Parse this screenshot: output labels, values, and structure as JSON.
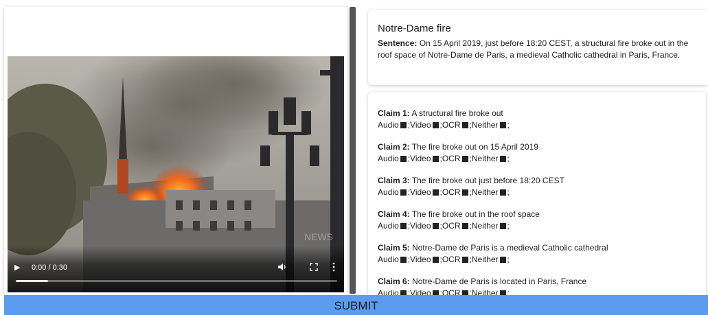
{
  "video": {
    "time": "0:00 / 0:30",
    "progress_fraction": 0.1,
    "watermark": "NEWS"
  },
  "sentence": {
    "title": "Notre-Dame fire",
    "label": "Sentence:",
    "text": " On 15 April 2019, just before 18:20 CEST, a structural fire broke out in the roof space of Notre-Dame de Paris, a medieval Catholic cathedral in Paris, France."
  },
  "claim_options": {
    "audio": "Audio",
    "video": ";Video",
    "ocr": ";OCR",
    "neither": ";Neither",
    "end": ";"
  },
  "claims": [
    {
      "label": "Claim 1:",
      "text": " A structural fire broke out"
    },
    {
      "label": "Claim 2:",
      "text": " The fire broke out on 15 April 2019"
    },
    {
      "label": "Claim 3:",
      "text": " The fire broke out just before 18:20 CEST"
    },
    {
      "label": "Claim 4:",
      "text": " The fire broke out in the roof space"
    },
    {
      "label": "Claim 5:",
      "text": " Notre-Dame de Paris is a medieval Catholic cathedral"
    },
    {
      "label": "Claim 6:",
      "text": " Notre-Dame de Paris is located in Paris, France"
    }
  ],
  "submit_label": "SUBMIT"
}
